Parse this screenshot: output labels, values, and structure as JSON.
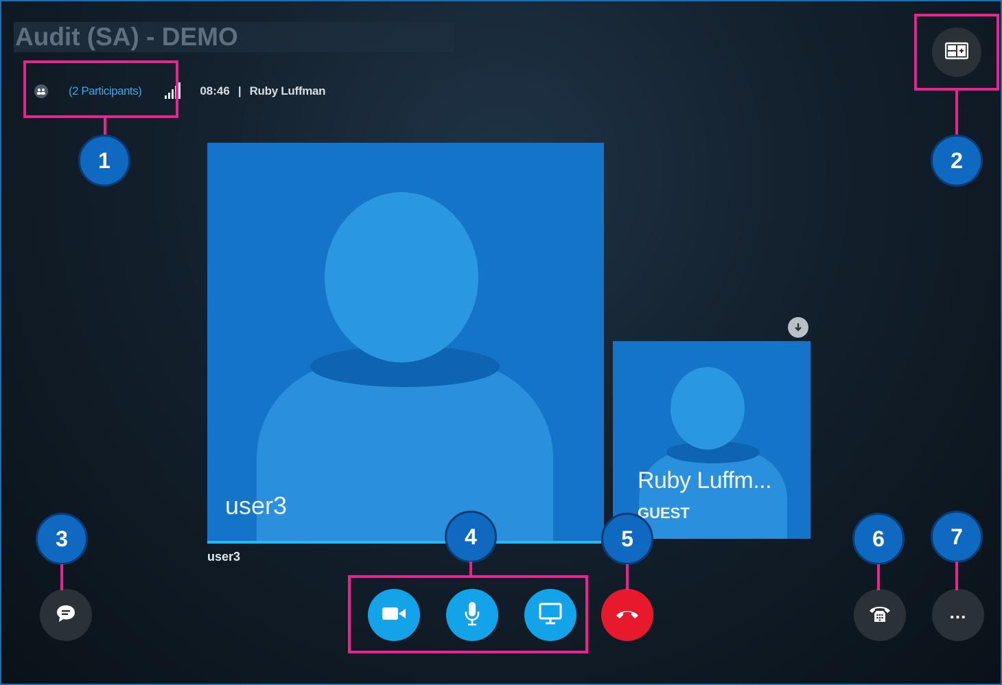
{
  "meeting": {
    "title": "Audit (SA) - DEMO",
    "participants_label": "(2 Participants)",
    "duration": "08:46",
    "separator": "|",
    "current_user": "Ruby Luffman"
  },
  "tiles": {
    "main": {
      "name": "user3",
      "caption": "user3"
    },
    "self": {
      "name": "Ruby Luffm...",
      "role": "GUEST"
    }
  },
  "callouts": [
    "1",
    "2",
    "3",
    "4",
    "5",
    "6",
    "7"
  ],
  "icons": {
    "participants": "people-icon",
    "signal": "signal-strength-icon",
    "layout": "layout-toggle-icon",
    "chat": "chat-bubble-icon",
    "video": "video-camera-icon",
    "mic": "microphone-icon",
    "share": "screen-share-icon",
    "hangup": "hang-up-icon",
    "dialpad": "phone-dialpad-icon",
    "more": "more-options-icon",
    "pin": "pin-arrow-icon"
  },
  "colors": {
    "highlight": "#e8258f",
    "callout": "#0f69c0",
    "action_blue": "#12a3e8",
    "hangup_red": "#e8192c",
    "link_blue": "#3aa6e6"
  }
}
